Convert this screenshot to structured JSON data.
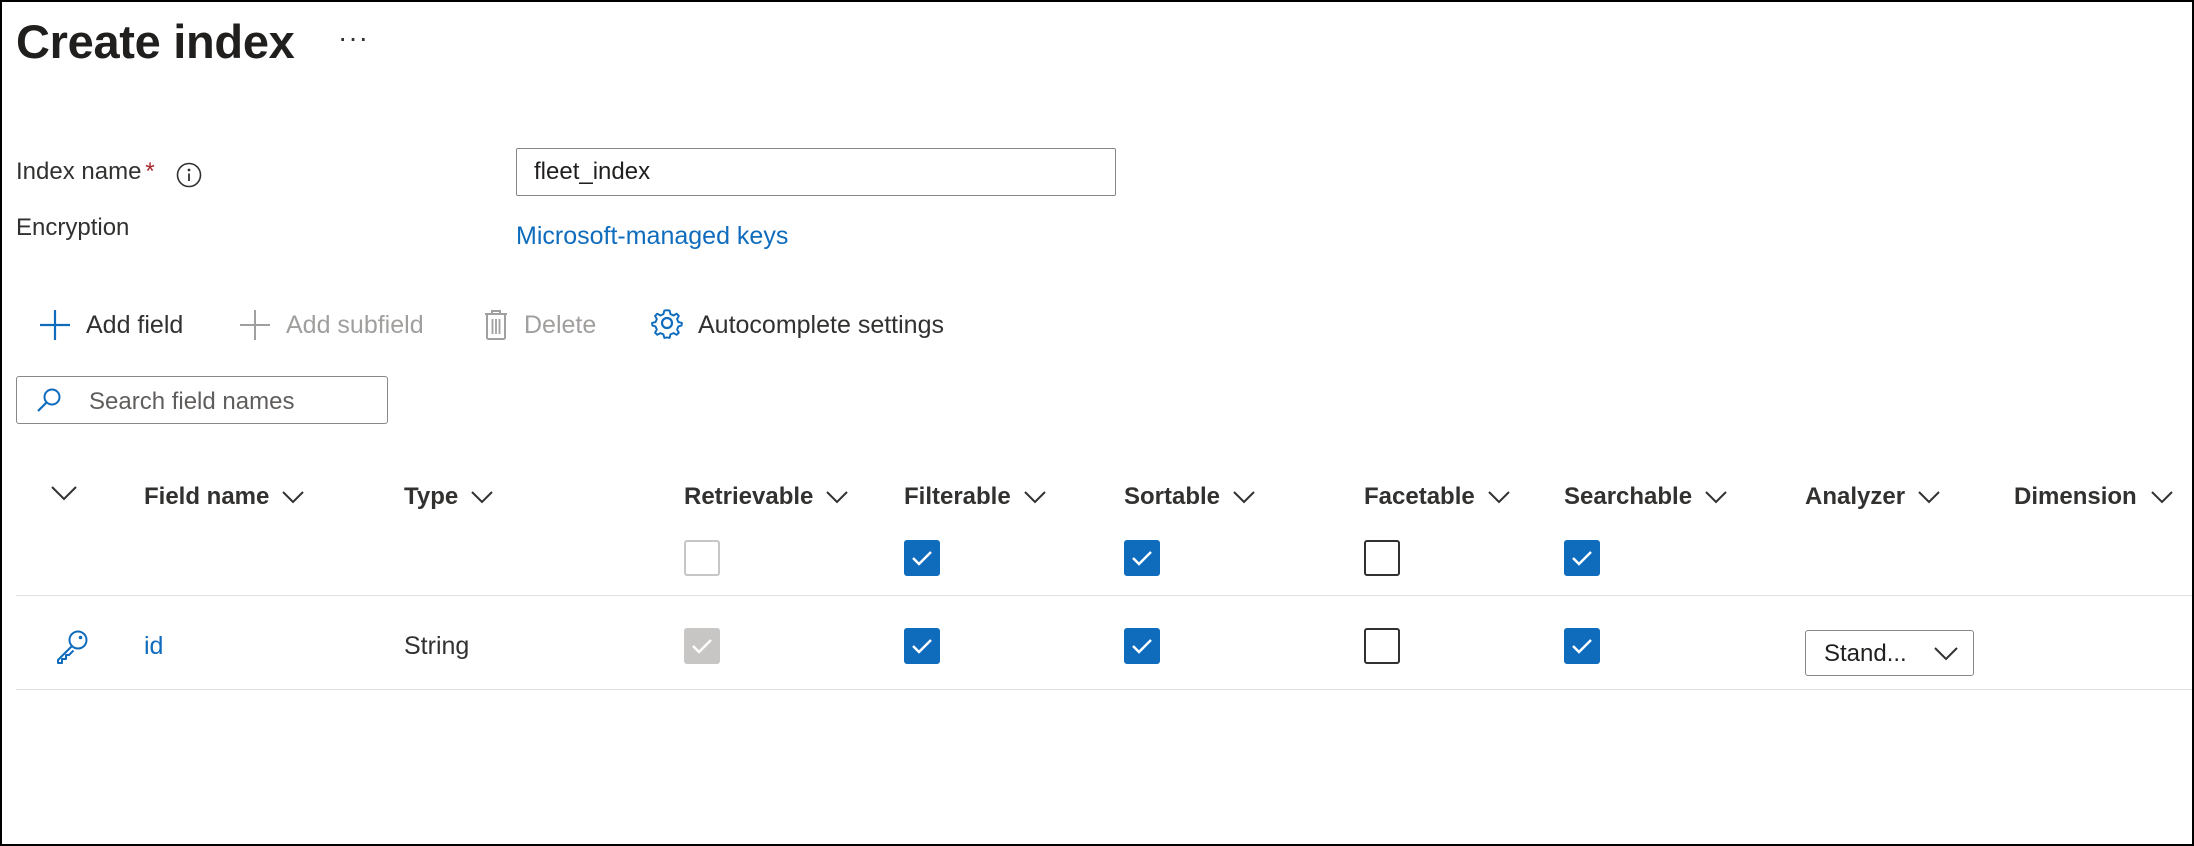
{
  "page": {
    "title": "Create index",
    "more_label": "···"
  },
  "form": {
    "index_name_label": "Index name",
    "required_mark": "*",
    "index_name_value": "fleet_index",
    "encryption_label": "Encryption",
    "encryption_link": "Microsoft-managed keys"
  },
  "toolbar": {
    "add_field": "Add field",
    "add_subfield": "Add subfield",
    "delete": "Delete",
    "autocomplete": "Autocomplete settings"
  },
  "search": {
    "placeholder": "Search field names"
  },
  "table": {
    "columns": {
      "field_name": "Field name",
      "type": "Type",
      "retrievable": "Retrievable",
      "filterable": "Filterable",
      "sortable": "Sortable",
      "facetable": "Facetable",
      "searchable": "Searchable",
      "analyzer": "Analyzer",
      "dimension": "Dimension"
    },
    "header_checks": {
      "retrievable": false,
      "filterable": true,
      "sortable": true,
      "facetable": false,
      "searchable": true
    },
    "rows": [
      {
        "icon": "key-icon",
        "field_name": "id",
        "type": "String",
        "retrievable": true,
        "retrievable_disabled": true,
        "filterable": true,
        "sortable": true,
        "facetable": false,
        "searchable": true,
        "analyzer": "Stand..."
      }
    ]
  },
  "colors": {
    "accent": "#0f6cbd",
    "text": "#323130",
    "disabled": "#a19f9d"
  }
}
